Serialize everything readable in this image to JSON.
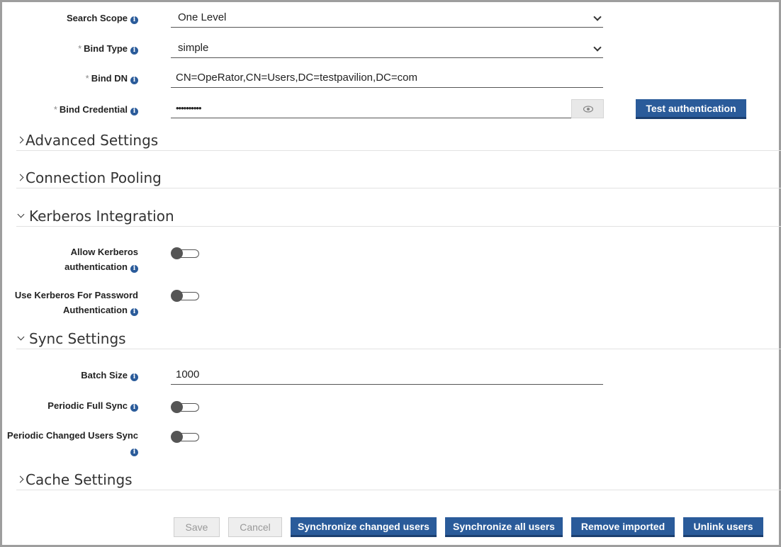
{
  "fields": {
    "search_scope": {
      "label": "Search Scope",
      "value": "One Level"
    },
    "bind_type": {
      "label": "Bind Type",
      "value": "simple"
    },
    "bind_dn": {
      "label": "Bind DN",
      "value": "CN=OpeRator,CN=Users,DC=testpavilion,DC=com"
    },
    "bind_credential": {
      "label": "Bind Credential",
      "value": "••••••••••"
    },
    "required_mark": "*",
    "info_glyph": "i"
  },
  "test_auth_label": "Test authentication",
  "sections": {
    "advanced": "Advanced Settings",
    "pooling": "Connection Pooling",
    "kerberos": "Kerberos Integration",
    "sync": "Sync Settings",
    "cache": "Cache Settings"
  },
  "kerberos": {
    "allow_line1": "Allow Kerberos",
    "allow_line2": "authentication",
    "allow_enabled": false,
    "use_line1": "Use Kerberos For Password",
    "use_line2": "Authentication",
    "use_enabled": false
  },
  "sync": {
    "batch_size_label": "Batch Size",
    "batch_size_value": "1000",
    "full_sync_label": "Periodic Full Sync",
    "full_sync_enabled": false,
    "changed_sync_label": "Periodic Changed Users Sync",
    "changed_sync_enabled": false
  },
  "actions": {
    "save": "Save",
    "cancel": "Cancel",
    "sync_changed": "Synchronize changed users",
    "sync_all": "Synchronize all users",
    "remove_imported": "Remove imported",
    "unlink": "Unlink users"
  },
  "icons": {
    "info": "info-icon",
    "eye": "eye-icon",
    "chevron": "chevron-icon"
  },
  "colors": {
    "primary": "#2a5b9a",
    "disabled_bg": "#eeeeee"
  }
}
